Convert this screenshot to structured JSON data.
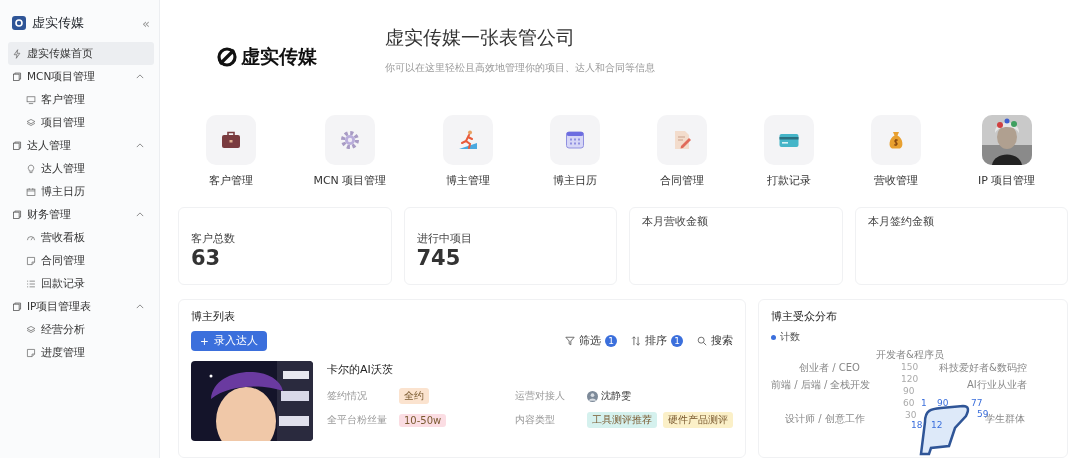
{
  "sidebar": {
    "brand": "虚实传媒",
    "collapse_glyph": "«",
    "items": [
      {
        "label": "虚实传媒首页",
        "selected": true
      },
      {
        "label": "MCN项目管理",
        "expanded": true,
        "children": [
          {
            "label": "客户管理",
            "selected": false
          },
          {
            "label": "项目管理",
            "selected": false
          }
        ]
      },
      {
        "label": "达人管理",
        "expanded": true,
        "children": [
          {
            "label": "达人管理",
            "selected": false
          },
          {
            "label": "博主日历",
            "selected": false
          }
        ]
      },
      {
        "label": "财务管理",
        "expanded": true,
        "children": [
          {
            "label": "营收看板",
            "selected": false
          },
          {
            "label": "合同管理",
            "selected": false
          },
          {
            "label": "回款记录",
            "selected": false
          }
        ]
      },
      {
        "label": "IP项目管理表",
        "expanded": true,
        "children": [
          {
            "label": "经营分析",
            "selected": false
          },
          {
            "label": "进度管理",
            "selected": false
          }
        ]
      }
    ]
  },
  "header": {
    "logo_text": "虚实传媒",
    "title": "虚实传媒一张表管公司",
    "subtitle": "你可以在这里轻松且高效地管理你的项目、达人和合同等信息"
  },
  "shortcuts": [
    {
      "label": "客户管理",
      "kind": "briefcase"
    },
    {
      "label": "MCN 项目管理",
      "kind": "gear"
    },
    {
      "label": "博主管理",
      "kind": "runner"
    },
    {
      "label": "博主日历",
      "kind": "calendar"
    },
    {
      "label": "合同管理",
      "kind": "document"
    },
    {
      "label": "打款记录",
      "kind": "card"
    },
    {
      "label": "营收管理",
      "kind": "moneybag"
    },
    {
      "label": "IP 项目管理",
      "kind": "picture"
    }
  ],
  "stats": [
    {
      "label": "客户总数",
      "value": "63"
    },
    {
      "label": "进行中项目",
      "value": "745"
    },
    {
      "label": "本月营收金额"
    },
    {
      "label": "本月签约金额"
    }
  ],
  "blogger_list": {
    "title": "博主列表",
    "add_button": "录入达人",
    "add_glyph": "+",
    "tools": [
      {
        "label": "筛选",
        "badge": "1",
        "kind": "filter"
      },
      {
        "label": "排序",
        "badge": "1",
        "kind": "sort"
      },
      {
        "label": "搜索",
        "kind": "search"
      }
    ],
    "card": {
      "name": "卡尔的AI沃茨",
      "fields": [
        {
          "label": "签约情况",
          "kind": "tags",
          "tags": [
            {
              "text": "全约",
              "color": "#fbe3cf"
            }
          ]
        },
        {
          "label": "运营对接人",
          "kind": "person",
          "value": "沈静雯"
        },
        {
          "label": "全平台粉丝量",
          "kind": "tags",
          "tags": [
            {
              "text": "10-50w",
              "color": "#fbdde3"
            }
          ]
        },
        {
          "label": "内容类型",
          "kind": "tags",
          "tags": [
            {
              "text": "工具测评推荐",
              "color": "#d5f1ee"
            },
            {
              "text": "硬件产品测评",
              "color": "#fbf0c8"
            }
          ]
        }
      ]
    }
  },
  "audience": {
    "title": "博主受众分布",
    "legend": "计数",
    "axes": [
      "开发者&程序员",
      "创业者 / CEO",
      "科技爱好者&数码控",
      "前端 / 后端 / 全栈开发",
      "AI行业从业者",
      "设计师 / 创意工作",
      "学生群体"
    ],
    "ticks": [
      "150",
      "120",
      "90",
      "60",
      "30"
    ],
    "value_labels": [
      "1",
      "90",
      "77",
      "59",
      "18",
      "12"
    ]
  }
}
